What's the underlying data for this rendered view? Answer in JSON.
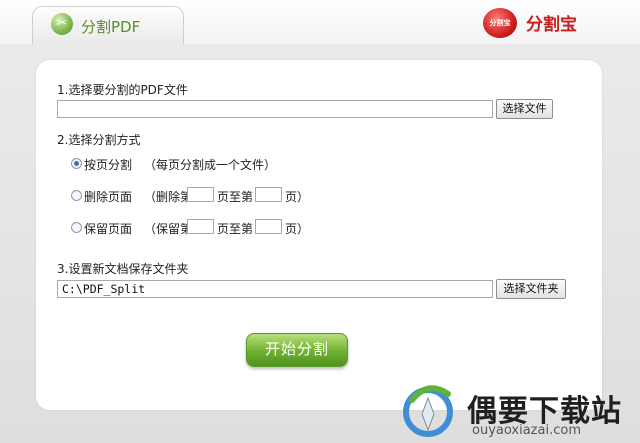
{
  "tab": {
    "label": "分割PDF",
    "icon": "scissors-icon"
  },
  "brand": {
    "logo_text": "分割宝",
    "name": "分割宝",
    "color": "#c71e1e"
  },
  "step1": {
    "label": "1.选择要分割的PDF文件",
    "file_path": "",
    "browse_label": "选择文件"
  },
  "step2": {
    "label": "2.选择分割方式",
    "options": [
      {
        "label": "按页分割",
        "desc": "（每页分割成一个文件）",
        "checked": true
      },
      {
        "label": "删除页面",
        "pre": "（删除第",
        "mid": "页至第",
        "post": "页）",
        "checked": false
      },
      {
        "label": "保留页面",
        "pre": "（保留第",
        "mid": "页至第",
        "post": "页）",
        "checked": false
      }
    ]
  },
  "step3": {
    "label": "3.设置新文档保存文件夹",
    "folder_path": "C:\\PDF_Split",
    "browse_label": "选择文件夹"
  },
  "start_button": {
    "label": "开始分割",
    "color": "#6fb12f"
  },
  "watermark": {
    "title": "偶要下载站",
    "url": "ouyaoxiazai.com"
  }
}
